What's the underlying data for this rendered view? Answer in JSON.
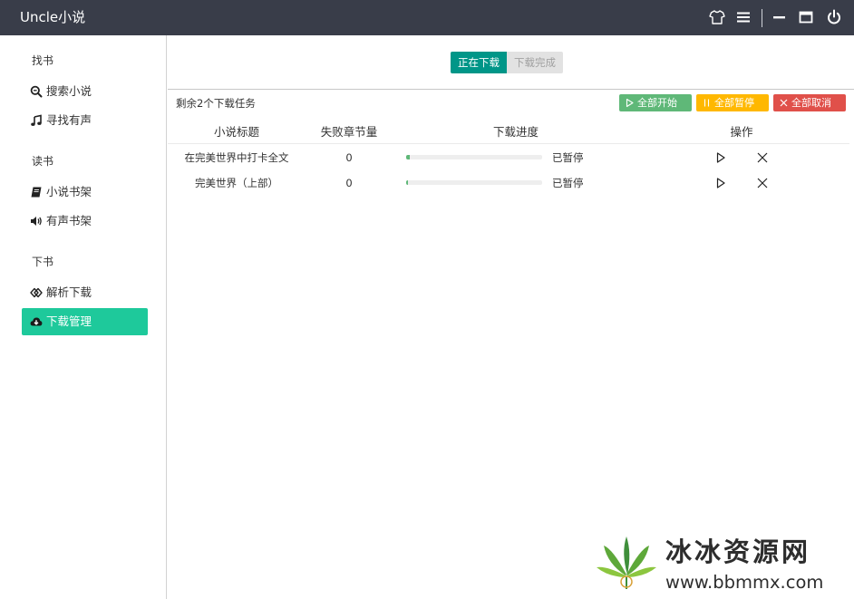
{
  "window": {
    "title": "Uncle小说"
  },
  "titlebar_icons": [
    "shirt-icon",
    "menu-icon",
    "minimize-icon",
    "maximize-icon",
    "power-icon"
  ],
  "sidebar": {
    "groups": [
      {
        "title": "找书",
        "items": [
          {
            "label": "搜索小说",
            "icon": "search-icon"
          },
          {
            "label": "寻找有声",
            "icon": "music-icon"
          }
        ]
      },
      {
        "title": "读书",
        "items": [
          {
            "label": "小说书架",
            "icon": "book-icon"
          },
          {
            "label": "有声书架",
            "icon": "volume-icon"
          }
        ]
      },
      {
        "title": "下书",
        "items": [
          {
            "label": "解析下载",
            "icon": "parse-icon"
          },
          {
            "label": "下载管理",
            "icon": "cloud-download-icon",
            "active": true
          }
        ]
      }
    ]
  },
  "tabs": {
    "downloading": "正在下载",
    "completed": "下载完成"
  },
  "toolbar": {
    "remaining": "剩余2个下载任务",
    "start_all": "全部开始",
    "pause_all": "全部暂停",
    "cancel_all": "全部取消"
  },
  "table": {
    "headers": [
      "小说标题",
      "失败章节量",
      "下载进度",
      "操作"
    ],
    "rows": [
      {
        "title": "在完美世界中打卡全文",
        "failed": "0",
        "progress": 0.025,
        "status": "已暂停"
      },
      {
        "title": "完美世界（上部）",
        "failed": "0",
        "progress": 0.01,
        "status": "已暂停"
      }
    ]
  },
  "colors": {
    "titlebar": "#393d49",
    "active_nav": "#1ec99b",
    "tab_active": "#009688",
    "start": "#5fb878",
    "pause": "#ffb800",
    "cancel": "#ff5722",
    "progress": "#5fb878"
  },
  "watermark": {
    "text": "冰冰资源网",
    "url": "www.bbmmx.com"
  }
}
